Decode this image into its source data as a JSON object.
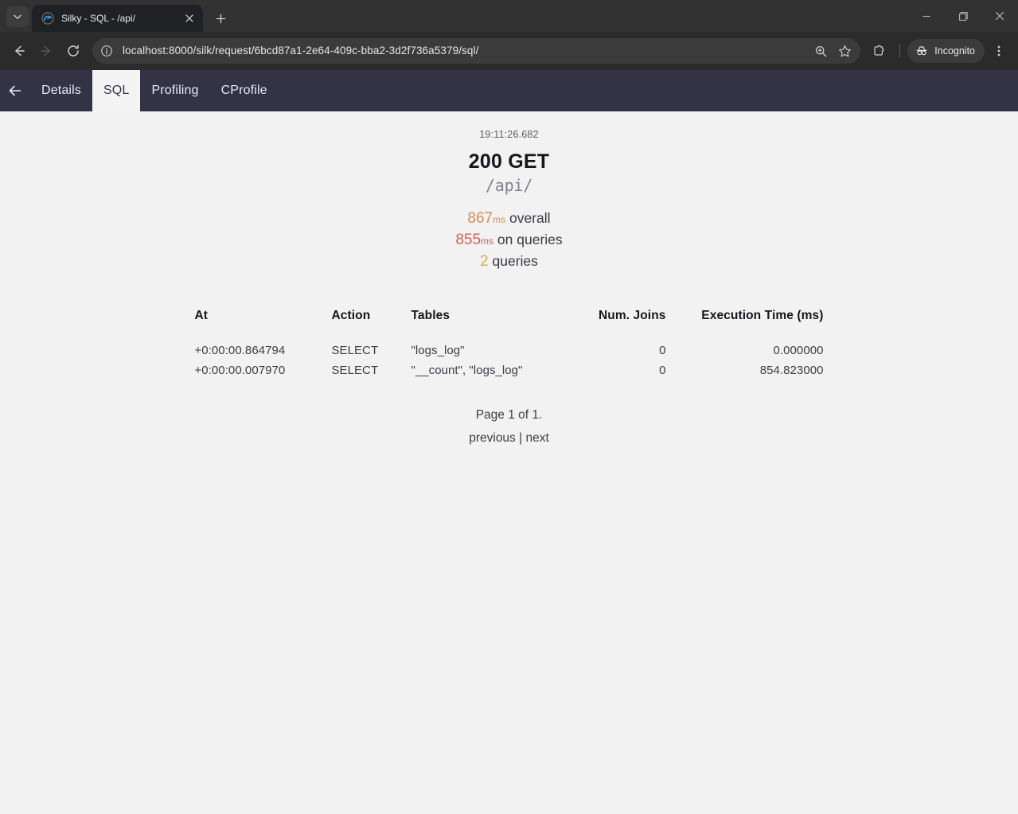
{
  "browser": {
    "tab": {
      "title": "Silky - SQL - /api/",
      "favicon": "silk-gauge-icon",
      "close_label": "×"
    },
    "new_tab_label": "+",
    "tab_search_label": "tab-search",
    "window_controls": {
      "minimize": "minimize",
      "maximize": "maximize",
      "close": "close"
    },
    "toolbar": {
      "back": "back",
      "forward": "forward",
      "reload": "reload",
      "site_info": "site-info",
      "url": "localhost:8000/silk/request/6bcd87a1-2e64-409c-bba2-3d2f736a5379/sql/",
      "url_placeholder": "Search Google or type a URL",
      "zoom": "zoom",
      "bookmark": "bookmark",
      "extensions": "extensions",
      "incognito_label": "Incognito",
      "menu": "menu"
    }
  },
  "silk": {
    "back_label": "back",
    "tabs": [
      {
        "label": "Details",
        "active": false
      },
      {
        "label": "SQL",
        "active": true
      },
      {
        "label": "Profiling",
        "active": false
      },
      {
        "label": "CProfile",
        "active": false
      }
    ],
    "header": {
      "timestamp": "19:11:26.682",
      "status": "200 GET",
      "path": "/api/",
      "overall_value": "867",
      "overall_unit": "ms",
      "overall_label": "overall",
      "queries_time_value": "855",
      "queries_time_unit": "ms",
      "queries_time_label": "on queries",
      "queries_count_value": "2",
      "queries_count_label": "queries"
    },
    "table": {
      "columns": [
        "At",
        "Action",
        "Tables",
        "Num. Joins",
        "Execution Time (ms)"
      ],
      "rows": [
        {
          "at": "+0:00:00.864794",
          "action": "SELECT",
          "tables": "\"logs_log\"",
          "joins": "0",
          "exec": "0.000000"
        },
        {
          "at": "+0:00:00.007970",
          "action": "SELECT",
          "tables": "\"__count\", \"logs_log\"",
          "joins": "0",
          "exec": "854.823000"
        }
      ]
    },
    "pagination": {
      "page_info": "Page 1 of 1.",
      "previous": "previous",
      "separator": "|",
      "next": "next"
    },
    "colors": {
      "nav_bg": "#343345",
      "page_bg": "#f2f2f2",
      "active_tab_bg": "#f4f4f4",
      "overall_accent": "#d98b52",
      "queries_accent": "#d4615b",
      "count_accent": "#d9ab52"
    }
  }
}
